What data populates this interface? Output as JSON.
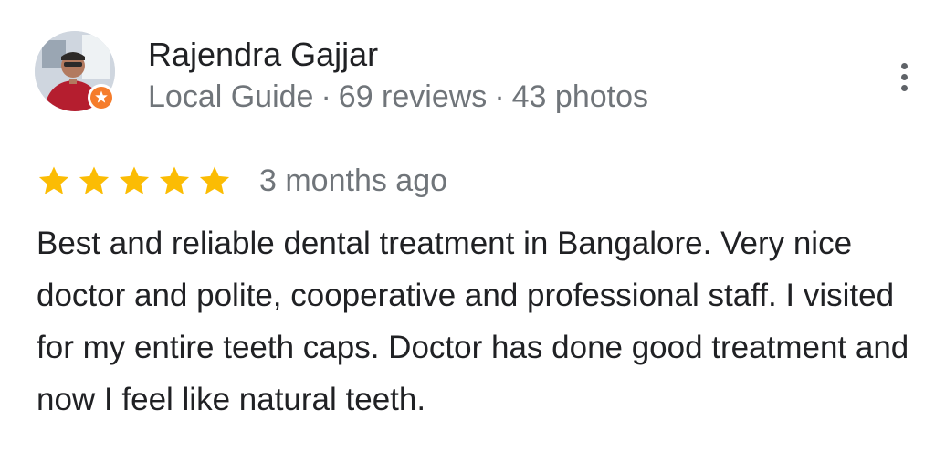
{
  "reviewer": {
    "name": "Rajendra Gajjar",
    "badge": "Local Guide",
    "reviews": "69 reviews",
    "photos": "43 photos",
    "separator": "·"
  },
  "review": {
    "rating": 5,
    "rating_max": 5,
    "time": "3 months ago",
    "text": "Best and reliable dental treatment in Bangalore. Very nice doctor and polite, cooperative and professional staff. I visited for my entire teeth caps. Doctor has done good treatment and now I feel like natural teeth."
  },
  "icons": {
    "avatar": "profile-photo",
    "badge": "local-guide-icon",
    "star": "star-icon",
    "menu": "more-vert-icon"
  },
  "colors": {
    "star": "#fbbc04",
    "badge": "#f57c2b",
    "primary_text": "#202124",
    "secondary_text": "#70757a",
    "menu_icon": "#5f6368"
  }
}
